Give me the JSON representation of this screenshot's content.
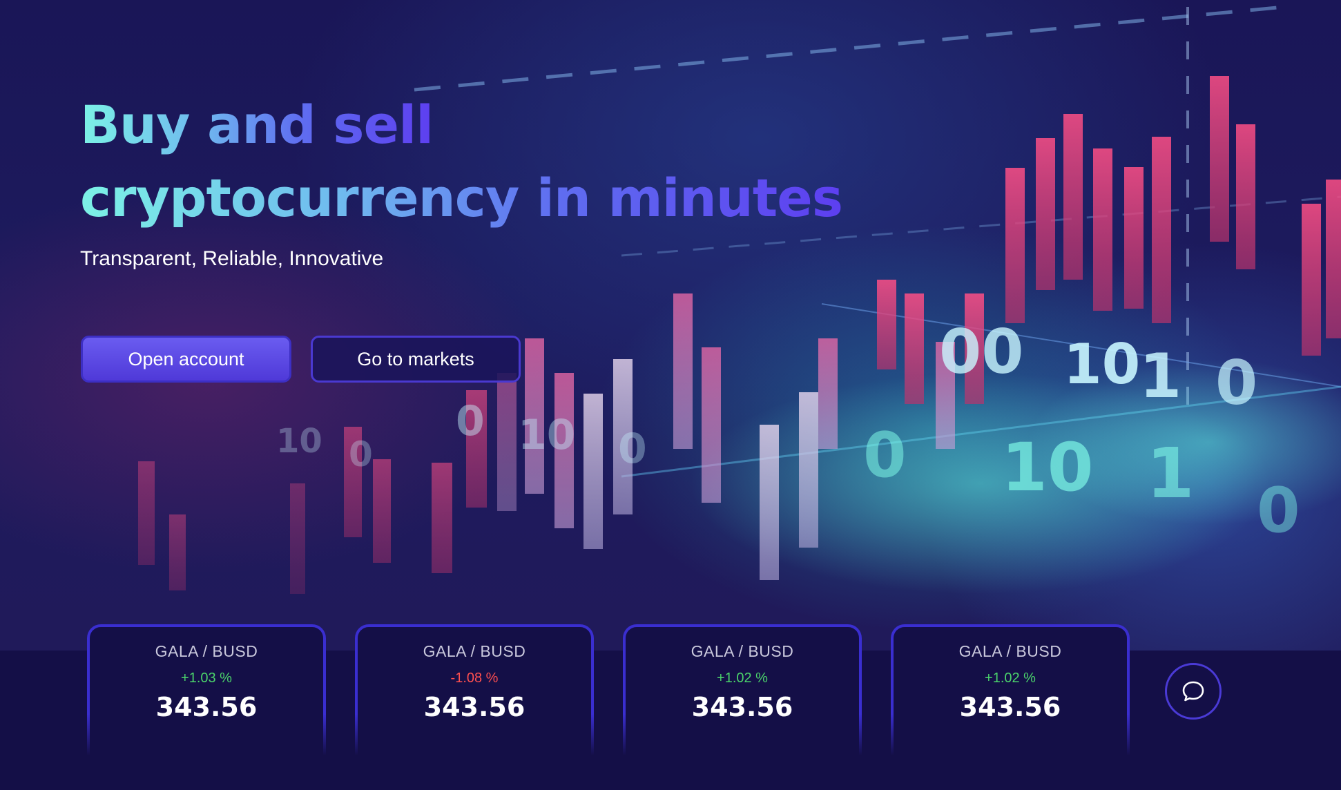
{
  "hero": {
    "headline_line1": "Buy and sell",
    "headline_line2": "cryptocurrency in minutes",
    "subtitle": "Transparent, Reliable, Innovative",
    "open_account_label": "Open account",
    "go_to_markets_label": "Go to markets"
  },
  "tickers": [
    {
      "pair": "GALA / BUSD",
      "change": "+1.03 %",
      "direction": "up",
      "price": "343.56"
    },
    {
      "pair": "GALA / BUSD",
      "change": "-1.08 %",
      "direction": "down",
      "price": "343.56"
    },
    {
      "pair": "GALA / BUSD",
      "change": "+1.02 %",
      "direction": "up",
      "price": "343.56"
    },
    {
      "pair": "GALA / BUSD",
      "change": "+1.02 %",
      "direction": "up",
      "price": "343.56"
    }
  ],
  "chat": {
    "icon": "chat-bubble-icon"
  },
  "colors": {
    "background": "#140f47",
    "accent": "#5d3ff0",
    "gradient_start": "#7cf2e6",
    "positive": "#4bd46b",
    "negative": "#ff4f4f"
  }
}
